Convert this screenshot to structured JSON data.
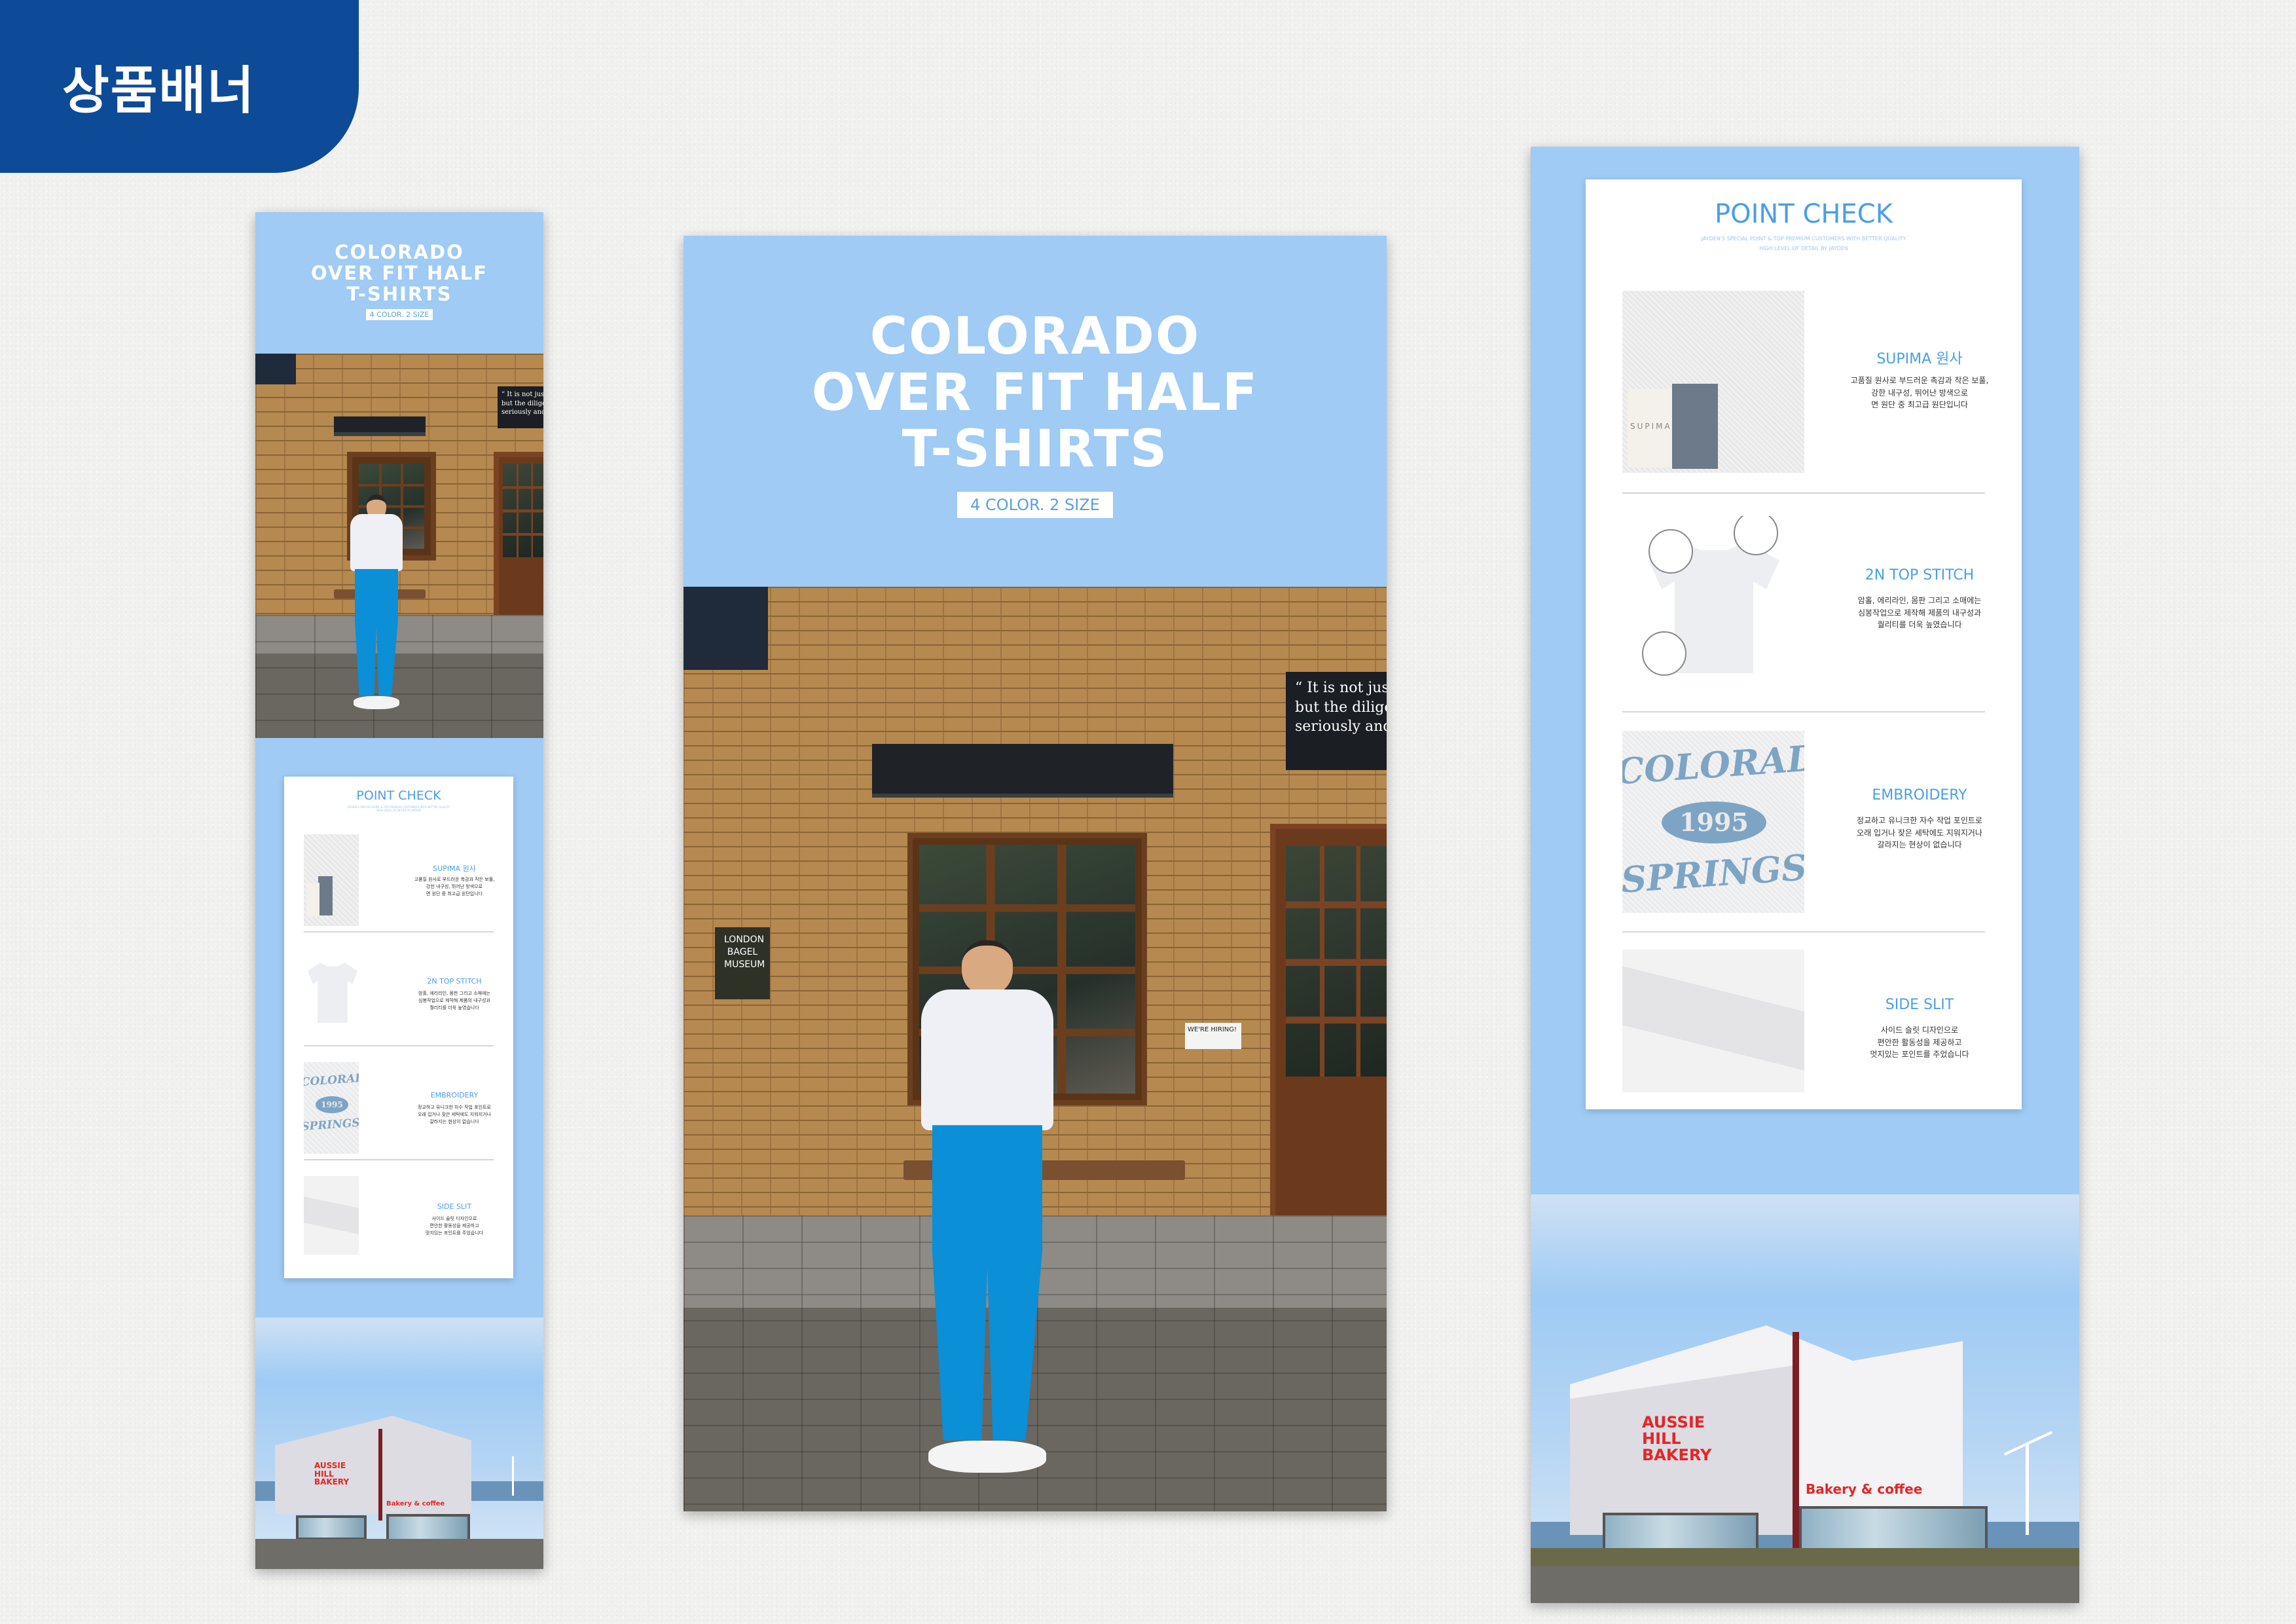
{
  "corner_tab": {
    "label": "상품배너"
  },
  "banner": {
    "title_lines": [
      "COLORADO",
      "OVER FIT HALF",
      "T-SHIRTS"
    ],
    "badge": "4 COLOR. 2 SIZE",
    "sign_lines": [
      "“ It is not just t",
      "but the diligenc",
      "seriously and ca"
    ],
    "menu_sign_lines": [
      "LONDON",
      "BAGEL",
      "MUSEUM"
    ],
    "hiring_sign": "WE'RE HIRING!"
  },
  "point_check": {
    "title": "POINT CHECK",
    "subtitle_lines": [
      "JAYDEN'S SPECIAL POINT & TOP PREMIUM CUSTOMERS WITH BETTER QUALITY",
      "HIGH LEVEL OF DETAIL BY JAYDEN"
    ],
    "items": [
      {
        "label": "SUPIMA 원사",
        "desc_lines": [
          "고품질 원사로 부드러운 촉감과 작은 보풀,",
          "강한 내구성, 뛰어난 방색으로",
          "면 원단 중 최고급 원단입니다"
        ],
        "thumb": "supima-fabric",
        "tag_text": "SUPIMA"
      },
      {
        "label": "2N TOP STITCH",
        "desc_lines": [
          "암홀, 에리라인, 몸판 그리고 소매에는",
          "심봉작업으로 제작해 제품의 내구성과",
          "퀄리티를 더욱 높였습니다"
        ],
        "thumb": "tshirt-stitch"
      },
      {
        "label": "EMBROIDERY",
        "desc_lines": [
          "정교하고 유니크한 자수 작업 포인트로",
          "오래 입거나 잦은 세탁에도 지워지거나",
          "갈라지는 현상이 없습니다"
        ],
        "thumb": "embroidery",
        "embro_top": "COLORADO",
        "embro_mid": "1995",
        "embro_bottom": "SPRINGS"
      },
      {
        "label": "SIDE SLIT",
        "desc_lines": [
          "사이드 슬릿 디자인으로",
          "편안한 활동성을 제공하고",
          "멋지있는 포인트를 주었습니다"
        ],
        "thumb": "side-slit"
      }
    ]
  },
  "bakery": {
    "name_lines": [
      "AUSSIE",
      "HILL",
      "BAKERY"
    ],
    "sub_sign": "Bakery & coffee"
  },
  "colors": {
    "accent_blue": "#9fcbf4",
    "brand_navy": "#0d4a97",
    "label_blue": "#4a9ee8"
  }
}
